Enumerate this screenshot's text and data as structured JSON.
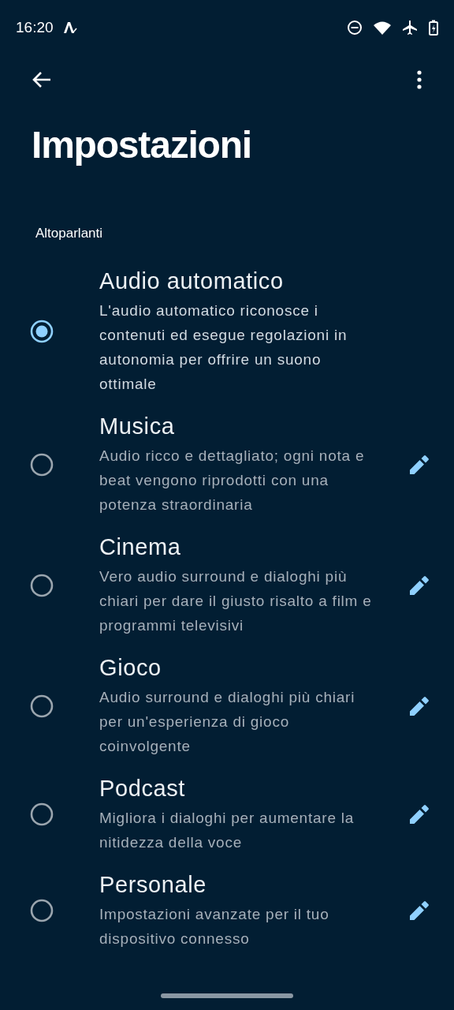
{
  "status_bar": {
    "time": "16:20"
  },
  "title": "Impostazioni",
  "section": "Altoparlanti",
  "options": [
    {
      "title": "Audio automatico",
      "description": "L'audio automatico riconosce i contenuti ed esegue regolazioni in autonomia per offrire un suono ottimale",
      "selected": true,
      "editable": false
    },
    {
      "title": "Musica",
      "description": "Audio ricco e dettagliato; ogni nota e beat vengono riprodotti con una potenza straordinaria",
      "selected": false,
      "editable": true
    },
    {
      "title": "Cinema",
      "description": "Vero audio surround e dialoghi più chiari per dare il giusto risalto a film e programmi televisivi",
      "selected": false,
      "editable": true
    },
    {
      "title": "Gioco",
      "description": "Audio surround e dialoghi più chiari per un'esperienza di gioco coinvolgente",
      "selected": false,
      "editable": true
    },
    {
      "title": "Podcast",
      "description": "Migliora i dialoghi per aumentare la nitidezza della voce",
      "selected": false,
      "editable": true
    },
    {
      "title": "Personale",
      "description": "Impostazioni avanzate per il tuo dispositivo connesso",
      "selected": false,
      "editable": true
    }
  ]
}
